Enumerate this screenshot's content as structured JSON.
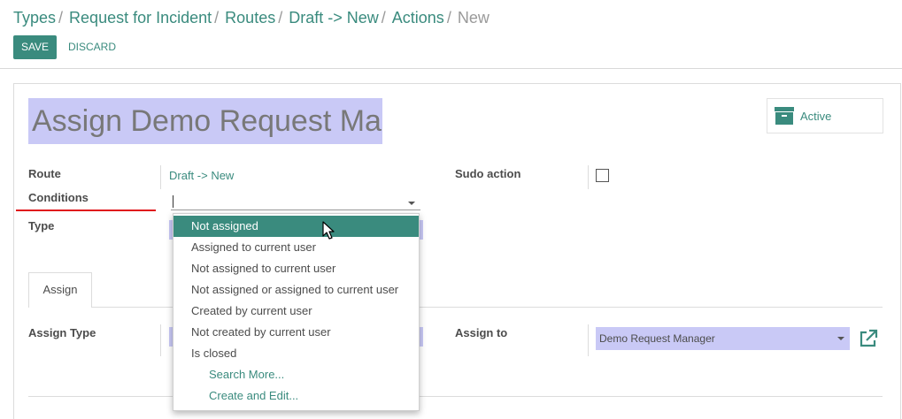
{
  "breadcrumb": {
    "items": [
      "Types",
      "Request for Incident",
      "Routes",
      "Draft -> New",
      "Actions"
    ],
    "separator": "/",
    "current": "New"
  },
  "toolbar": {
    "save_label": "SAVE",
    "discard_label": "DISCARD"
  },
  "form": {
    "title": "Assign Demo Request Manager",
    "active_label": "Active",
    "labels": {
      "route": "Route",
      "conditions": "Conditions",
      "type": "Type",
      "sudo_action": "Sudo action",
      "assign_type": "Assign Type",
      "assign_to": "Assign to"
    },
    "route_value": "Draft -> New",
    "sudo_checked": false,
    "assign_to_value": "Demo Request Manager",
    "tabs": [
      "Assign"
    ]
  },
  "conditions_dropdown": {
    "options": [
      "Not assigned",
      "Assigned to current user",
      "Not assigned to current user",
      "Not assigned or assigned to current user",
      "Created by current user",
      "Not created by current user",
      "Is closed"
    ],
    "selected": "Not assigned",
    "search_more": "Search More...",
    "create_edit": "Create and Edit..."
  },
  "colors": {
    "accent": "#3a8b7e",
    "required_field": "#c9c9f6",
    "highlight_underline": "#e0161c"
  },
  "icons": [
    "archive-icon",
    "external-link-icon",
    "mouse-cursor-icon",
    "dropdown-arrow-icon"
  ]
}
